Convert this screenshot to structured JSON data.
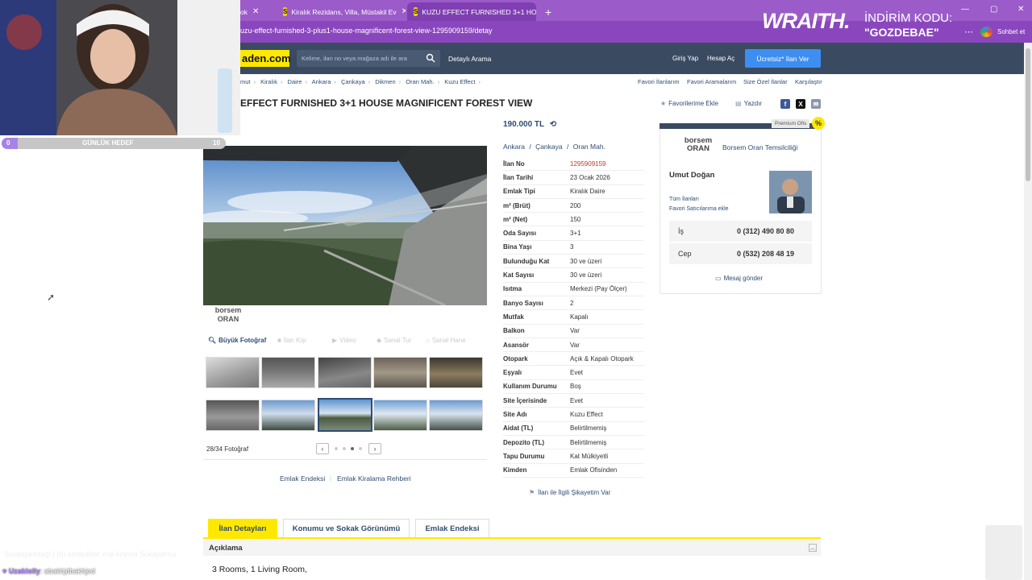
{
  "browser": {
    "tabs": [
      {
        "label": "ok"
      },
      {
        "label": "Kiralık Rezidans, Villa, Müstakil Ev"
      },
      {
        "label": "KUZU EFFECT FURNISHED 3+1 HO"
      }
    ],
    "new_tab": "+",
    "url": "uzu-effect-furnished-3-plus1-house-magnificent-forest-view-1295909159/detay",
    "chat_label": "Sohbet et"
  },
  "header": {
    "logo": "aden.com",
    "search_placeholder": "Kelime, ilan no veya mağaza adı ile ara",
    "detailed_search": "Detaylı Arama",
    "login": "Giriş Yap",
    "signup": "Hesap Aç",
    "post_ad": "Ücretsiz* İlan Ver"
  },
  "breadcrumb": [
    "mut",
    "Kiralık",
    "Daire",
    "Ankara",
    "Çankaya",
    "Dikmen",
    "Oran Mah.",
    "Kuzu Effect"
  ],
  "top_links": [
    "Favori İlanlarım",
    "Favori Aramalarım",
    "Size Özel İlanlar",
    "Karşılaştır"
  ],
  "listing": {
    "title": "EFFECT FURNISHED 3+1 HOUSE MAGNIFICENT FOREST VIEW",
    "favorite": "Favorilerime Ekle",
    "print": "Yazdır",
    "price": "190.000 TL",
    "location": [
      "Ankara",
      "Çankaya",
      "Oran Mah."
    ],
    "location_sep": "/",
    "brand_line1": "borsem",
    "brand_line2": "ORAN",
    "photo_tools": [
      "Büyük Fotoğraf",
      "İlan Kişi",
      "Video",
      "Sanal Tur",
      "Sanal Hane"
    ],
    "photo_count": "28/34 Fotoğraf",
    "page_prev": "‹",
    "page_next": "›",
    "below_links": [
      "Emlak Endeksi",
      "Emlak Kiralama Rehberi"
    ],
    "complaint": "İlan ile İlgili Şikayetim Var"
  },
  "specs": [
    {
      "k": "İlan No",
      "v": "1295909159"
    },
    {
      "k": "İlan Tarihi",
      "v": "23 Ocak 2026"
    },
    {
      "k": "Emlak Tipi",
      "v": "Kiralık Daire"
    },
    {
      "k": "m² (Brüt)",
      "v": "200"
    },
    {
      "k": "m² (Net)",
      "v": "150"
    },
    {
      "k": "Oda Sayısı",
      "v": "3+1"
    },
    {
      "k": "Bina Yaşı",
      "v": "3"
    },
    {
      "k": "Bulunduğu Kat",
      "v": "30 ve üzeri"
    },
    {
      "k": "Kat Sayısı",
      "v": "30 ve üzeri"
    },
    {
      "k": "Isıtma",
      "v": "Merkezi (Pay Ölçer)"
    },
    {
      "k": "Banyo Sayısı",
      "v": "2"
    },
    {
      "k": "Mutfak",
      "v": "Kapalı"
    },
    {
      "k": "Balkon",
      "v": "Var"
    },
    {
      "k": "Asansör",
      "v": "Var"
    },
    {
      "k": "Otopark",
      "v": "Açık & Kapalı Otopark"
    },
    {
      "k": "Eşyalı",
      "v": "Evet"
    },
    {
      "k": "Kullanım Durumu",
      "v": "Boş"
    },
    {
      "k": "Site İçerisinde",
      "v": "Evet"
    },
    {
      "k": "Site Adı",
      "v": "Kuzu Effect"
    },
    {
      "k": "Aidat (TL)",
      "v": "Belirtilmemiş"
    },
    {
      "k": "Depozito (TL)",
      "v": "Belirtilmemiş"
    },
    {
      "k": "Tapu Durumu",
      "v": "Kat Mülkiyetli"
    },
    {
      "k": "Kimden",
      "v": "Emlak Ofisinden"
    }
  ],
  "seller": {
    "premium": "Premium Ofis",
    "badge": "%",
    "agency_logo1": "borsem",
    "agency_logo2": "ORAN",
    "agency_name": "Borsem Oran Temsilciliği",
    "agent": "Umut Doğan",
    "all_ads": "Tüm İlanları",
    "fav_seller": "Favori Satıcılarıma ekle",
    "work_label": "İş",
    "work_phone": "0 (312) 490 80 80",
    "mobile_label": "Cep",
    "mobile_phone": "0 (532) 208 48 19",
    "message": "Mesaj gönder"
  },
  "bottom_tabs": [
    "İlan Detayları",
    "Konumu ve Sokak Görünümü",
    "Emlak Endeksi"
  ],
  "description": {
    "title": "Açıklama",
    "text": "3 Rooms, 1 Living Room,"
  },
  "overlay": {
    "goal_left": "0",
    "goal_title": "GÜNLÜK HEDEF",
    "goal_right": "10",
    "chat_user": "Uzaklolly",
    "chat_msg": ": abakhjdbakhjed",
    "ghost": "Sodaspeedagt | Bu sesledikte ona koyma Sokayatma",
    "sponsor": "WRAITH.",
    "promo_line1": "İNDİRİM KODU:",
    "promo_line2": "\"GOZDEBAE\""
  }
}
